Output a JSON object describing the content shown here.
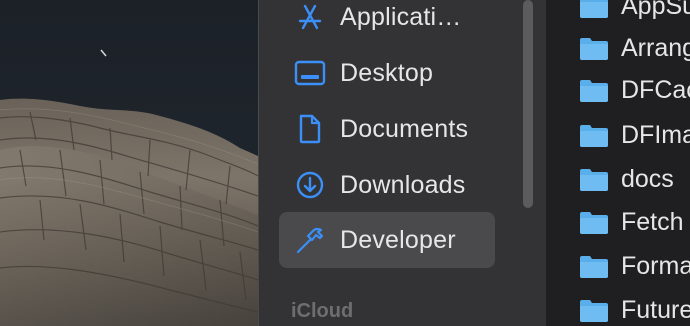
{
  "sidebar": {
    "items": [
      {
        "label": "Applicati…",
        "icon": "applications-icon",
        "selected": false
      },
      {
        "label": "Desktop",
        "icon": "desktop-icon",
        "selected": false
      },
      {
        "label": "Documents",
        "icon": "document-icon",
        "selected": false
      },
      {
        "label": "Downloads",
        "icon": "downloads-icon",
        "selected": false
      },
      {
        "label": "Developer",
        "icon": "hammer-icon",
        "selected": true
      }
    ],
    "section_label": "iCloud"
  },
  "files": {
    "items": [
      {
        "name": "AppSu"
      },
      {
        "name": "Arrang"
      },
      {
        "name": "DFCac"
      },
      {
        "name": "DFIma"
      },
      {
        "name": "docs"
      },
      {
        "name": "Fetch"
      },
      {
        "name": "Forma"
      },
      {
        "name": "Future"
      }
    ]
  },
  "colors": {
    "accent": "#3b8ff6",
    "folder": "#5aaeea",
    "sidebar_bg": "#333335",
    "selected_bg": "#4a4a4c"
  }
}
